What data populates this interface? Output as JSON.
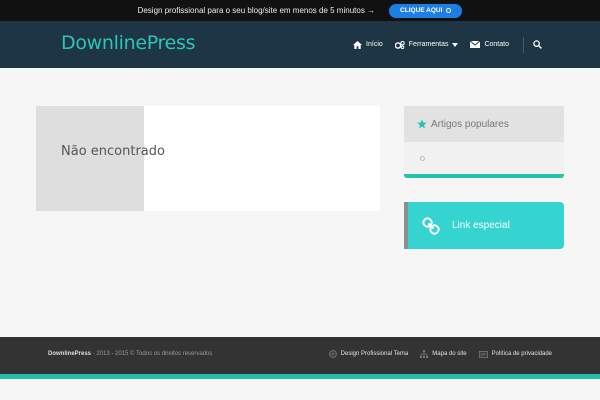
{
  "promo": {
    "text": "Design profissional para o seu blog/site em menos de 5 minutos →",
    "button_label": "CLIQUE AQUI"
  },
  "header": {
    "logo": "DownlinePress",
    "nav": [
      {
        "label": "Início",
        "icon": "home-icon"
      },
      {
        "label": "Ferramentas",
        "icon": "gears-icon",
        "has_dropdown": true
      },
      {
        "label": "Contato",
        "icon": "envelope-icon"
      }
    ],
    "search_icon": "search-icon"
  },
  "main": {
    "title": "Não encontrado"
  },
  "sidebar": {
    "popular": {
      "title": "Artigos populares",
      "icon": "star-icon"
    },
    "special": {
      "label": "Link especial",
      "icon": "chain-link-icon"
    }
  },
  "footer": {
    "brand": "DownlinePress",
    "copyright": " · 2013 - 2015 © Todos os direitos reservados",
    "links": [
      {
        "label": "Design Profissional Tema",
        "icon": "globe-icon"
      },
      {
        "label": "Mapa do site",
        "icon": "sitemap-icon"
      },
      {
        "label": "Política de privacidade",
        "icon": "document-icon"
      }
    ]
  },
  "colors": {
    "accent": "#2ec4b8",
    "header_bg": "#1e3545",
    "promo_button": "#1d7fe3",
    "special_bg": "#35d4d0",
    "footer_bg": "#333333"
  }
}
